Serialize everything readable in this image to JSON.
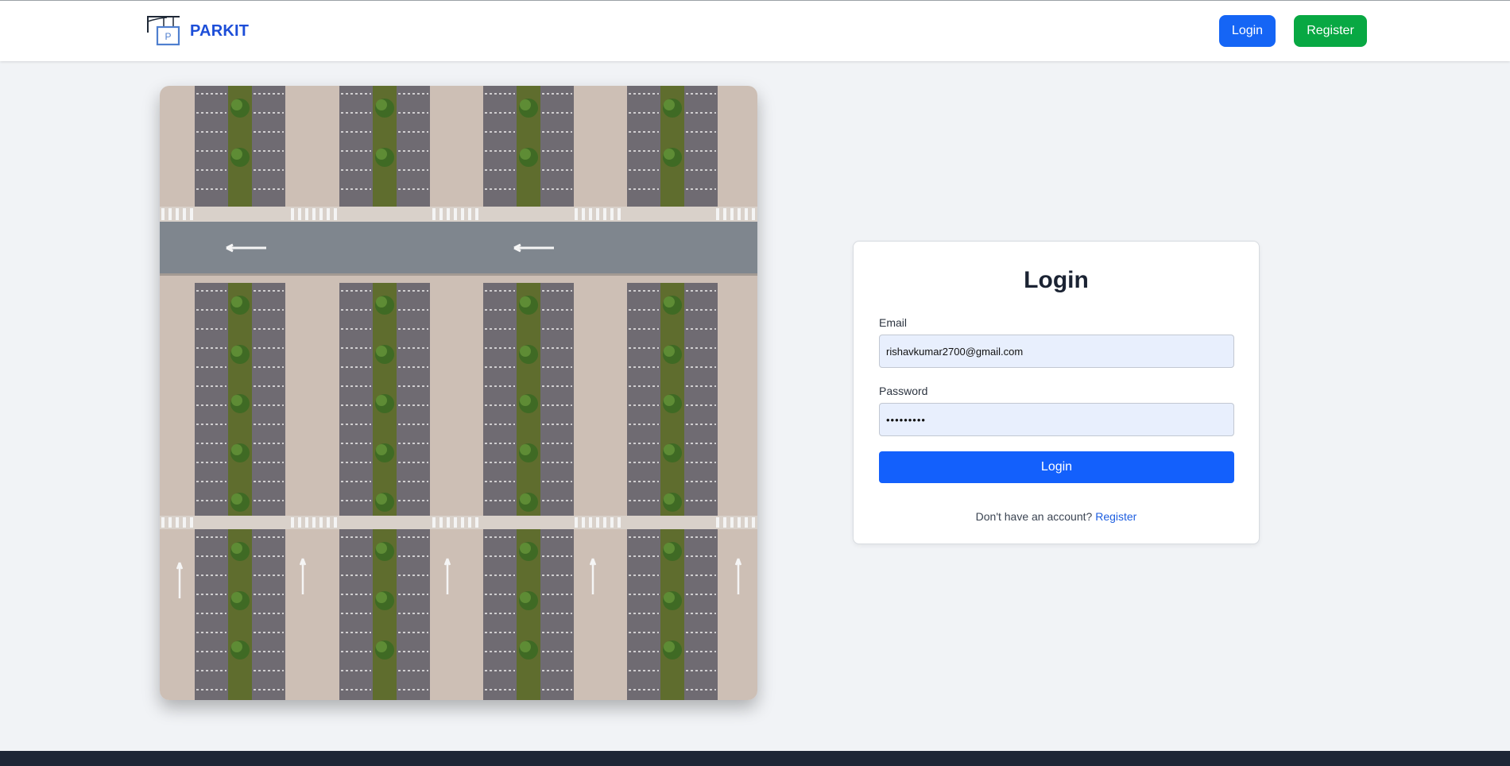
{
  "header": {
    "brand_name": "PARKIT",
    "login_label": "Login",
    "register_label": "Register"
  },
  "hero_image": {
    "subject": "aerial view of parking lot"
  },
  "login_form": {
    "title": "Login",
    "email_label": "Email",
    "email_value": "rishavkumar2700@gmail.com",
    "password_label": "Password",
    "password_value": "•••••••••",
    "submit_label": "Login",
    "signup_prompt": "Don't have an account?",
    "signup_link": "Register"
  },
  "colors": {
    "brand": "#1d4ed8",
    "primary": "#1360fc",
    "success": "#08a843",
    "page_bg": "#f1f3f6",
    "footer_bg": "#1e2636",
    "input_bg": "#e8effd"
  }
}
